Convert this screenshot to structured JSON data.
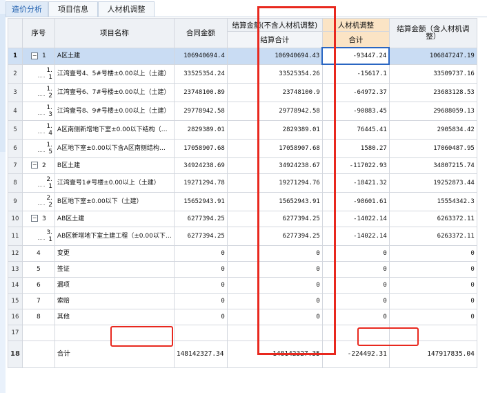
{
  "tabs": [
    {
      "label": "造价分析",
      "active": true
    },
    {
      "label": "项目信息",
      "active": false
    },
    {
      "label": "人材机调整",
      "active": false
    }
  ],
  "columns": {
    "seq": "序号",
    "name": "项目名称",
    "contract": "合同金额",
    "settle_excl": "结算金额(不含人材机调整)",
    "settle_excl_sub": "结算合计",
    "labor_adj": "人材机调整",
    "labor_adj_sub": "合计",
    "settle_incl": "结算金额（含人材机调整）"
  },
  "rows": [
    {
      "rn": "1",
      "tree": "minus",
      "seq": "1",
      "name": "A区土建",
      "contract": "106940694.4",
      "settle": "106940694.43",
      "adj": "-93447.24",
      "incl": "106847247.19",
      "selected": true
    },
    {
      "rn": "2",
      "tree": "child",
      "seq": "1.\n1",
      "name": "江湾壹号4、5#号楼±0.00以上（土建）",
      "contract": "33525354.24",
      "settle": "33525354.26",
      "adj": "-15617.1",
      "incl": "33509737.16"
    },
    {
      "rn": "3",
      "tree": "child",
      "seq": "1.\n2",
      "name": "江湾壹号6、7#号楼±0.00以上（土建）",
      "contract": "23748100.89",
      "settle": "23748100.9",
      "adj": "-64972.37",
      "incl": "23683128.53"
    },
    {
      "rn": "4",
      "tree": "child",
      "seq": "1.\n3",
      "name": "江湾壹号8、9#号楼±0.00以上（土建）",
      "contract": "29778942.58",
      "settle": "29778942.58",
      "adj": "-90883.45",
      "incl": "29688059.13"
    },
    {
      "rn": "5",
      "tree": "child",
      "seq": "1.\n4",
      "name": "A区南侧新增地下室±0.00以下结构（…",
      "contract": "2829389.01",
      "settle": "2829389.01",
      "adj": "76445.41",
      "incl": "2905834.42"
    },
    {
      "rn": "6",
      "tree": "child",
      "seq": "1.\n5",
      "name": "A区地下室±0.00以下含A区南侧结构…",
      "contract": "17058907.68",
      "settle": "17058907.68",
      "adj": "1580.27",
      "incl": "17060487.95"
    },
    {
      "rn": "7",
      "tree": "minus",
      "seq": "2",
      "name": "B区土建",
      "contract": "34924238.69",
      "settle": "34924238.67",
      "adj": "-117022.93",
      "incl": "34807215.74"
    },
    {
      "rn": "8",
      "tree": "child",
      "seq": "2.\n1",
      "name": "江湾壹号1#号楼±0.00以上（土建）",
      "contract": "19271294.78",
      "settle": "19271294.76",
      "adj": "-18421.32",
      "incl": "19252873.44"
    },
    {
      "rn": "9",
      "tree": "child",
      "seq": "2.\n2",
      "name": "B区地下室±0.00以下（土建）",
      "contract": "15652943.91",
      "settle": "15652943.91",
      "adj": "-98601.61",
      "incl": "15554342.3"
    },
    {
      "rn": "10",
      "tree": "minus",
      "seq": "3",
      "name": "AB区土建",
      "contract": "6277394.25",
      "settle": "6277394.25",
      "adj": "-14022.14",
      "incl": "6263372.11"
    },
    {
      "rn": "11",
      "tree": "child",
      "seq": "3.\n1",
      "name": "AB区新增地下室土建工程（±0.00以下…",
      "contract": "6277394.25",
      "settle": "6277394.25",
      "adj": "-14022.14",
      "incl": "6263372.11"
    },
    {
      "rn": "12",
      "tree": "none",
      "seq": "4",
      "name": "变更",
      "contract": "0",
      "settle": "0",
      "adj": "0",
      "incl": "0"
    },
    {
      "rn": "13",
      "tree": "none",
      "seq": "5",
      "name": "签证",
      "contract": "0",
      "settle": "0",
      "adj": "0",
      "incl": "0"
    },
    {
      "rn": "14",
      "tree": "none",
      "seq": "6",
      "name": "漏项",
      "contract": "0",
      "settle": "0",
      "adj": "0",
      "incl": "0"
    },
    {
      "rn": "15",
      "tree": "none",
      "seq": "7",
      "name": "索赔",
      "contract": "0",
      "settle": "0",
      "adj": "0",
      "incl": "0"
    },
    {
      "rn": "16",
      "tree": "none",
      "seq": "8",
      "name": "其他",
      "contract": "0",
      "settle": "0",
      "adj": "0",
      "incl": "0"
    },
    {
      "rn": "17",
      "tree": "none",
      "seq": "",
      "name": "",
      "contract": "",
      "settle": "",
      "adj": "",
      "incl": ""
    }
  ],
  "total": {
    "rn": "18",
    "name": "合计",
    "contract": "148142327.34",
    "settle": "148142327.35",
    "adj": "-224492.31",
    "incl": "147917835.04"
  },
  "colors": {
    "highlight": "#e8281e",
    "selection": "#c9dcf3",
    "accent": "#2a66c2"
  }
}
